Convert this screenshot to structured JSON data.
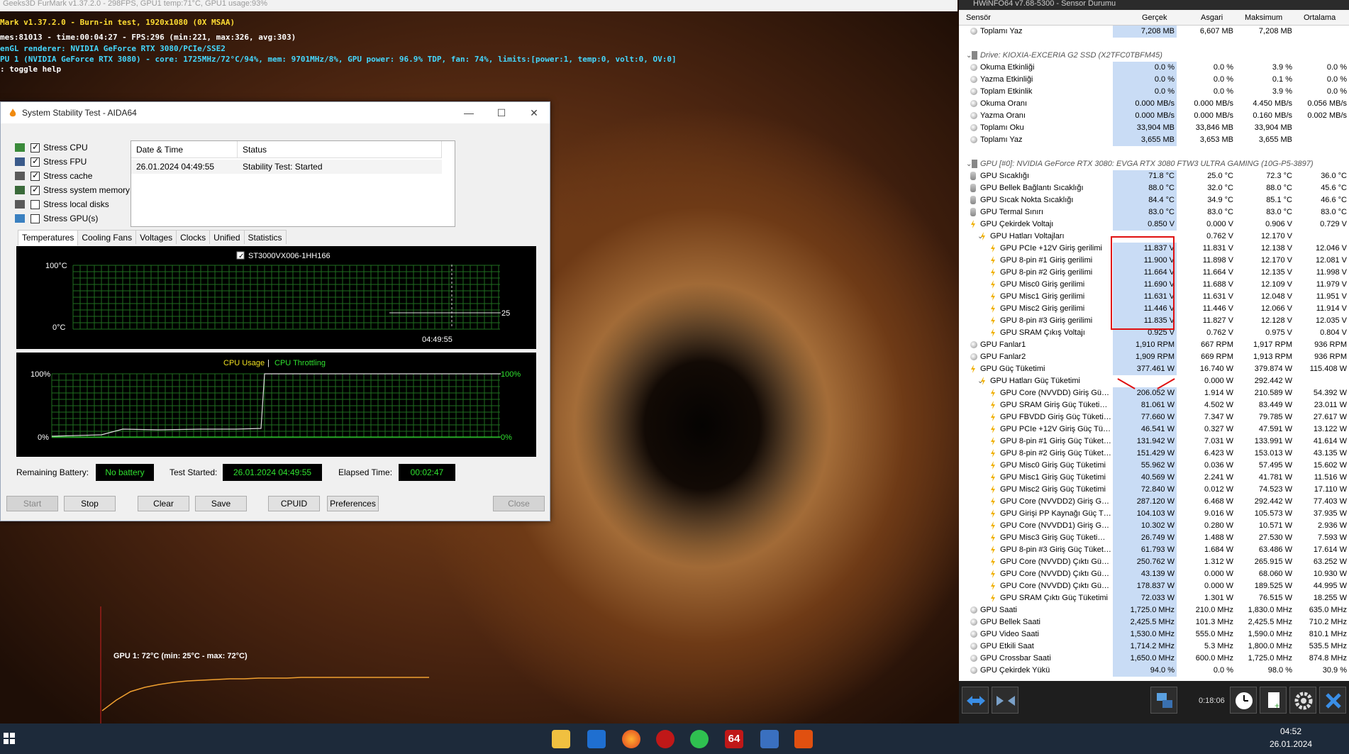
{
  "furmark": {
    "title": "Geeks3D FurMark v1.37.2.0 - 298FPS, GPU1 temp:71°C, GPU1 usage:93%",
    "line1": "Mark v1.37.2.0 - Burn-in test, 1920x1080 (0X MSAA)",
    "line2": "mes:81013 - time:00:04:27 - FPS:296 (min:221, max:326, avg:303)",
    "line3": "enGL renderer: NVIDIA GeForce RTX 3080/PCIe/SSE2",
    "line4": "PU 1 (NVIDIA GeForce RTX 3080) - core: 1725MHz/72°C/94%, mem: 9701MHz/8%, GPU power: 96.9% TDP, fan: 74%, limits:[power:1, temp:0, volt:0, OV:0]",
    "line5": ": toggle help"
  },
  "aida": {
    "title": "System Stability Test - AIDA64",
    "win_min": "—",
    "win_max": "☐",
    "win_close": "✕",
    "stress_items": [
      {
        "label": "Stress CPU",
        "checked": true
      },
      {
        "label": "Stress FPU",
        "checked": true
      },
      {
        "label": "Stress cache",
        "checked": true
      },
      {
        "label": "Stress system memory",
        "checked": true
      },
      {
        "label": "Stress local disks",
        "checked": false
      },
      {
        "label": "Stress GPU(s)",
        "checked": false
      }
    ],
    "log_headers": {
      "date": "Date & Time",
      "status": "Status"
    },
    "log_rows": [
      {
        "date": "26.01.2024 04:49:55",
        "status": "Stability Test: Started"
      }
    ],
    "tabs": [
      "Temperatures",
      "Cooling Fans",
      "Voltages",
      "Clocks",
      "Unified",
      "Statistics"
    ],
    "graph1": {
      "legend": "ST3000VX006-1HH166",
      "y_top": "100°C",
      "y_bottom": "0°C",
      "value": "25",
      "time": "04:49:55"
    },
    "graph2": {
      "legend_a": "CPU Usage",
      "legend_sep": "|",
      "legend_b": "CPU Throttling",
      "y_top_l": "100%",
      "y_bottom_l": "0%",
      "y_top_r": "100%",
      "y_bottom_r": "0%"
    },
    "remaining_label": "Remaining Battery:",
    "remaining_value": "No battery",
    "started_label": "Test Started:",
    "started_value": "26.01.2024 04:49:55",
    "elapsed_label": "Elapsed Time:",
    "elapsed_value": "00:02:47",
    "buttons": {
      "start": "Start",
      "stop": "Stop",
      "clear": "Clear",
      "save": "Save",
      "cpuid": "CPUID",
      "prefs": "Preferences",
      "close": "Close"
    }
  },
  "hwinfo": {
    "title": "HWiNFO64 v7.68-5300 - Sensor Durumu",
    "headers": {
      "sensor": "Sensör",
      "current": "Gerçek",
      "min": "Asgari",
      "max": "Maksimum",
      "avg": "Ortalama"
    },
    "rows": [
      {
        "t": "g",
        "n": "Toplamı Yaz",
        "v": [
          "7,208 MB",
          "6,607 MB",
          "7,208 MB",
          ""
        ],
        "i": 1
      },
      {
        "t": "blank"
      },
      {
        "t": "sec",
        "n": "Drive: KIOXIA-EXCERIA G2 SSD (X2TFC0TBFM45)",
        "v": [
          "",
          "",
          "",
          ""
        ]
      },
      {
        "t": "g",
        "n": "Okuma Etkinliği",
        "v": [
          "0.0 %",
          "0.0 %",
          "3.9 %",
          "0.0 %"
        ],
        "i": 1
      },
      {
        "t": "g",
        "n": "Yazma Etkinliği",
        "v": [
          "0.0 %",
          "0.0 %",
          "0.1 %",
          "0.0 %"
        ],
        "i": 1
      },
      {
        "t": "g",
        "n": "Toplam Etkinlik",
        "v": [
          "0.0 %",
          "0.0 %",
          "3.9 %",
          "0.0 %"
        ],
        "i": 1
      },
      {
        "t": "g",
        "n": "Okuma Oranı",
        "v": [
          "0.000 MB/s",
          "0.000 MB/s",
          "4.450 MB/s",
          "0.056 MB/s"
        ],
        "i": 1
      },
      {
        "t": "g",
        "n": "Yazma Oranı",
        "v": [
          "0.000 MB/s",
          "0.000 MB/s",
          "0.160 MB/s",
          "0.002 MB/s"
        ],
        "i": 1
      },
      {
        "t": "g",
        "n": "Toplamı Oku",
        "v": [
          "33,904 MB",
          "33,846 MB",
          "33,904 MB",
          ""
        ],
        "i": 1
      },
      {
        "t": "g",
        "n": "Toplamı Yaz",
        "v": [
          "3,655 MB",
          "3,653 MB",
          "3,655 MB",
          ""
        ],
        "i": 1
      },
      {
        "t": "blank"
      },
      {
        "t": "sec",
        "n": "GPU [#0]: NVIDIA GeForce RTX 3080: EVGA RTX 3080 FTW3 ULTRA GAMING (10G-P5-3897)",
        "v": [
          "",
          "",
          "",
          ""
        ]
      },
      {
        "t": "th",
        "n": "GPU Sıcaklığı",
        "v": [
          "71.8 °C",
          "25.0 °C",
          "72.3 °C",
          "36.0 °C"
        ],
        "i": 1
      },
      {
        "t": "th",
        "n": "GPU Bellek Bağlantı Sıcaklığı",
        "v": [
          "88.0 °C",
          "32.0 °C",
          "88.0 °C",
          "45.6 °C"
        ],
        "i": 1
      },
      {
        "t": "th",
        "n": "GPU Sıcak Nokta Sıcaklığı",
        "v": [
          "84.4 °C",
          "34.9 °C",
          "85.1 °C",
          "46.6 °C"
        ],
        "i": 1
      },
      {
        "t": "th",
        "n": "GPU Termal Sınırı",
        "v": [
          "83.0 °C",
          "83.0 °C",
          "83.0 °C",
          "83.0 °C"
        ],
        "i": 1
      },
      {
        "t": "b",
        "n": "GPU Çekirdek Voltajı",
        "v": [
          "0.850 V",
          "0.000 V",
          "0.906 V",
          "0.729 V"
        ],
        "i": 1
      },
      {
        "t": "bx",
        "n": "GPU Hatları Voltajları",
        "v": [
          "",
          "0.762 V",
          "12.170 V",
          ""
        ],
        "i": 2
      },
      {
        "t": "b",
        "n": "GPU PCIe +12V Giriş gerilimi",
        "v": [
          "11.837 V",
          "11.831 V",
          "12.138 V",
          "12.046 V"
        ],
        "i": 3
      },
      {
        "t": "b",
        "n": "GPU 8-pin #1 Giriş gerilimi",
        "v": [
          "11.900 V",
          "11.898 V",
          "12.170 V",
          "12.081 V"
        ],
        "i": 3
      },
      {
        "t": "b",
        "n": "GPU 8-pin #2 Giriş gerilimi",
        "v": [
          "11.664 V",
          "11.664 V",
          "12.135 V",
          "11.998 V"
        ],
        "i": 3
      },
      {
        "t": "b",
        "n": "GPU Misc0 Giriş gerilimi",
        "v": [
          "11.690 V",
          "11.688 V",
          "12.109 V",
          "11.979 V"
        ],
        "i": 3
      },
      {
        "t": "b",
        "n": "GPU Misc1 Giriş gerilimi",
        "v": [
          "11.631 V",
          "11.631 V",
          "12.048 V",
          "11.951 V"
        ],
        "i": 3
      },
      {
        "t": "b",
        "n": "GPU Misc2 Giriş gerilimi",
        "v": [
          "11.446 V",
          "11.446 V",
          "12.066 V",
          "11.914 V"
        ],
        "i": 3
      },
      {
        "t": "b",
        "n": "GPU 8-pin #3 Giriş gerilimi",
        "v": [
          "11.835 V",
          "11.827 V",
          "12.128 V",
          "12.035 V"
        ],
        "i": 3
      },
      {
        "t": "b",
        "n": "GPU SRAM Çıkış Voltajı",
        "v": [
          "0.925 V",
          "0.762 V",
          "0.975 V",
          "0.804 V"
        ],
        "i": 3
      },
      {
        "t": "f",
        "n": "GPU Fanlar1",
        "v": [
          "1,910 RPM",
          "667 RPM",
          "1,917 RPM",
          "936 RPM"
        ],
        "i": 1
      },
      {
        "t": "f",
        "n": "GPU Fanlar2",
        "v": [
          "1,909 RPM",
          "669 RPM",
          "1,913 RPM",
          "936 RPM"
        ],
        "i": 1
      },
      {
        "t": "b",
        "n": "GPU Güç Tüketimi",
        "v": [
          "377.461 W",
          "16.740 W",
          "379.874 W",
          "115.408 W"
        ],
        "i": 1
      },
      {
        "t": "bx",
        "n": "GPU Hatları Güç Tüketimi",
        "v": [
          "",
          "0.000 W",
          "292.442 W",
          ""
        ],
        "i": 2
      },
      {
        "t": "b",
        "n": "GPU Core (NVVDD) Giriş Güç T...",
        "v": [
          "206.052 W",
          "1.914 W",
          "210.589 W",
          "54.392 W"
        ],
        "i": 3
      },
      {
        "t": "b",
        "n": "GPU SRAM Giriş Güç Tüketimi ...",
        "v": [
          "81.061 W",
          "4.502 W",
          "83.449 W",
          "23.011 W"
        ],
        "i": 3
      },
      {
        "t": "b",
        "n": "GPU FBVDD Giriş Güç Tüketimi...",
        "v": [
          "77.660 W",
          "7.347 W",
          "79.785 W",
          "27.617 W"
        ],
        "i": 3
      },
      {
        "t": "b",
        "n": "GPU PCIe +12V Giriş Güç Tük...",
        "v": [
          "46.541 W",
          "0.327 W",
          "47.591 W",
          "13.122 W"
        ],
        "i": 3
      },
      {
        "t": "b",
        "n": "GPU 8-pin #1 Giriş Güç Tüketimi",
        "v": [
          "131.942 W",
          "7.031 W",
          "133.991 W",
          "41.614 W"
        ],
        "i": 3
      },
      {
        "t": "b",
        "n": "GPU 8-pin #2 Giriş Güç Tüketimi",
        "v": [
          "151.429 W",
          "6.423 W",
          "153.013 W",
          "43.135 W"
        ],
        "i": 3
      },
      {
        "t": "b",
        "n": "GPU Misc0 Giriş Güç Tüketimi",
        "v": [
          "55.962 W",
          "0.036 W",
          "57.495 W",
          "15.602 W"
        ],
        "i": 3
      },
      {
        "t": "b",
        "n": "GPU Misc1 Giriş Güç Tüketimi",
        "v": [
          "40.569 W",
          "2.241 W",
          "41.781 W",
          "11.516 W"
        ],
        "i": 3
      },
      {
        "t": "b",
        "n": "GPU Misc2 Giriş Güç Tüketimi",
        "v": [
          "72.840 W",
          "0.012 W",
          "74.523 W",
          "17.110 W"
        ],
        "i": 3
      },
      {
        "t": "b",
        "n": "GPU Core (NVVDD2) Giriş Güç ...",
        "v": [
          "287.120 W",
          "6.468 W",
          "292.442 W",
          "77.403 W"
        ],
        "i": 3
      },
      {
        "t": "b",
        "n": "GPU Girişi PP Kaynağı Güç Tük...",
        "v": [
          "104.103 W",
          "9.016 W",
          "105.573 W",
          "37.935 W"
        ],
        "i": 3
      },
      {
        "t": "b",
        "n": "GPU Core (NVVDD1) Giriş Güç ...",
        "v": [
          "10.302 W",
          "0.280 W",
          "10.571 W",
          "2.936 W"
        ],
        "i": 3
      },
      {
        "t": "b",
        "n": "GPU Misc3 Giriş Güç Tüketimi (...",
        "v": [
          "26.749 W",
          "1.488 W",
          "27.530 W",
          "7.593 W"
        ],
        "i": 3
      },
      {
        "t": "b",
        "n": "GPU 8-pin #3 Giriş Güç Tüketimi",
        "v": [
          "61.793 W",
          "1.684 W",
          "63.486 W",
          "17.614 W"
        ],
        "i": 3
      },
      {
        "t": "b",
        "n": "GPU Core (NVVDD) Çıktı Güç T...",
        "v": [
          "250.762 W",
          "1.312 W",
          "265.915 W",
          "63.252 W"
        ],
        "i": 3
      },
      {
        "t": "b",
        "n": "GPU Core (NVVDD) Çıktı Güç T...",
        "v": [
          "43.139 W",
          "0.000 W",
          "68.060 W",
          "10.930 W"
        ],
        "i": 3
      },
      {
        "t": "b",
        "n": "GPU Core (NVVDD) Çıktı Güç T...",
        "v": [
          "178.837 W",
          "0.000 W",
          "189.525 W",
          "44.995 W"
        ],
        "i": 3
      },
      {
        "t": "b",
        "n": "GPU SRAM Çıktı Güç Tüketimi",
        "v": [
          "72.033 W",
          "1.301 W",
          "76.515 W",
          "18.255 W"
        ],
        "i": 3
      },
      {
        "t": "g",
        "n": "GPU Saati",
        "v": [
          "1,725.0 MHz",
          "210.0 MHz",
          "1,830.0 MHz",
          "635.0 MHz"
        ],
        "i": 1
      },
      {
        "t": "g",
        "n": "GPU Bellek Saati",
        "v": [
          "2,425.5 MHz",
          "101.3 MHz",
          "2,425.5 MHz",
          "710.2 MHz"
        ],
        "i": 1
      },
      {
        "t": "g",
        "n": "GPU Video Saati",
        "v": [
          "1,530.0 MHz",
          "555.0 MHz",
          "1,590.0 MHz",
          "810.1 MHz"
        ],
        "i": 1
      },
      {
        "t": "g",
        "n": "GPU Etkili Saat",
        "v": [
          "1,714.2 MHz",
          "5.3 MHz",
          "1,800.0 MHz",
          "535.5 MHz"
        ],
        "i": 1
      },
      {
        "t": "g",
        "n": "GPU Crossbar Saati",
        "v": [
          "1,650.0 MHz",
          "600.0 MHz",
          "1,725.0 MHz",
          "874.8 MHz"
        ],
        "i": 1
      },
      {
        "t": "g",
        "n": "GPU Çekirdek Yükü",
        "v": [
          "94.0 %",
          "0.0 %",
          "98.0 %",
          "30.9 %"
        ],
        "i": 1
      }
    ],
    "timer": "0:18:06"
  },
  "tempchart": {
    "label": "GPU 1: 72°C (min: 25°C - max: 72°C)",
    "chart_data": {
      "type": "line",
      "series": [
        {
          "name": "GPU 1",
          "values": [
            25,
            40,
            52,
            58,
            62,
            65,
            67,
            68,
            69,
            70,
            70,
            71,
            71,
            71,
            72,
            72,
            72,
            72,
            72,
            72,
            72,
            72,
            72,
            72
          ]
        }
      ],
      "ylim": [
        0,
        100
      ]
    }
  },
  "taskbar": {
    "time": "04:52",
    "date": "26.01.2024",
    "aida_badge": "64"
  },
  "colors": {
    "accent_green": "#2fe02f",
    "grid_green": "#1f6e1f",
    "red_highlight": "#e01010",
    "temp_line": "#f0a030"
  }
}
